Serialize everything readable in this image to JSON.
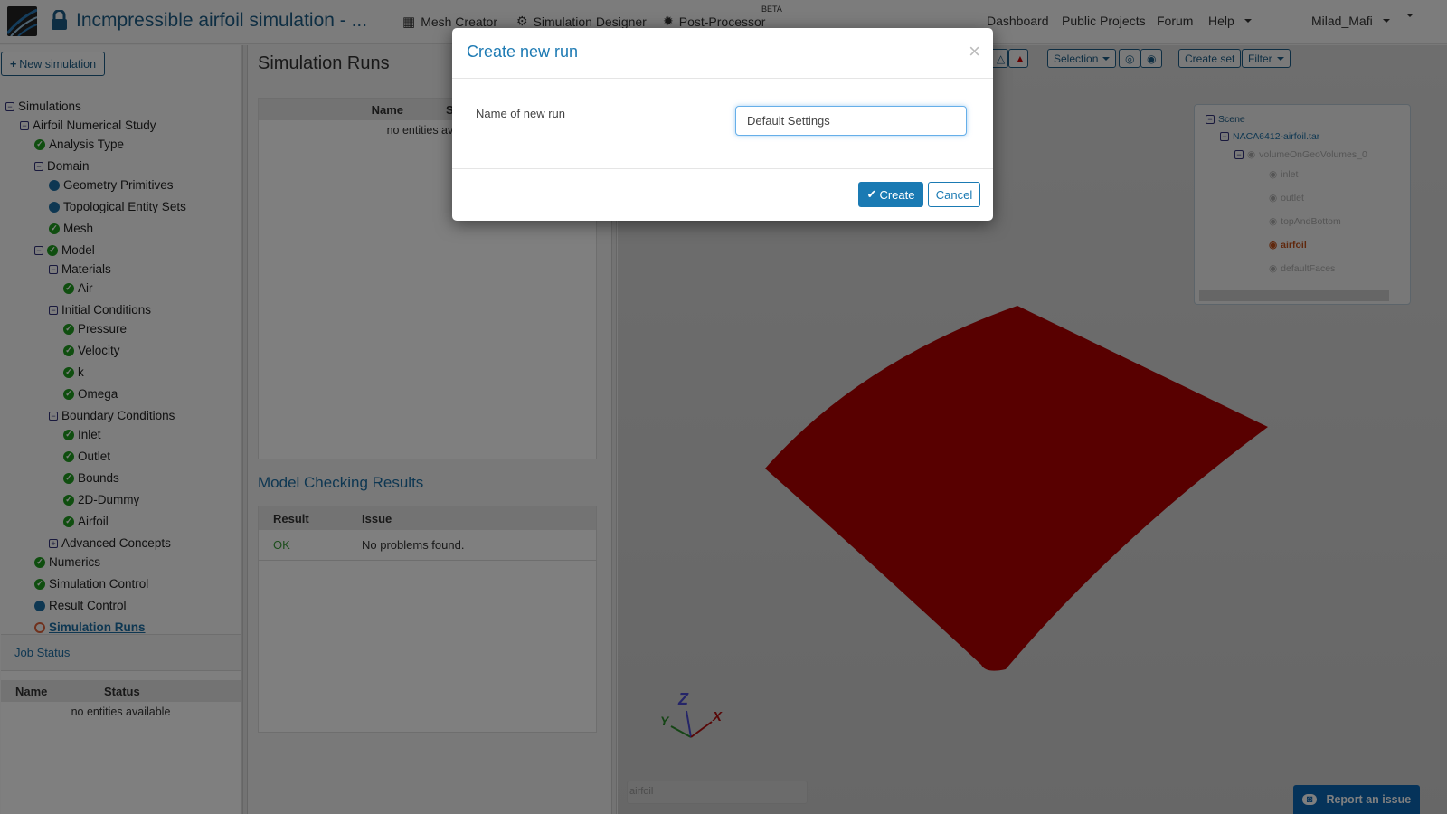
{
  "header": {
    "title": "Incmpressible airfoil simulation - ...",
    "nav": [
      "Mesh Creator",
      "Simulation Designer",
      "Post-Processor"
    ],
    "beta": "BETA",
    "right": [
      "Dashboard",
      "Public Projects",
      "Forum",
      "Help"
    ],
    "user": "Milad_Mafi"
  },
  "sidebar": {
    "new_simulation": "New simulation",
    "tree": [
      {
        "label": "Simulations",
        "level": 0,
        "icon": "minus"
      },
      {
        "label": "Airfoil Numerical Study",
        "level": 1,
        "icon": "minus"
      },
      {
        "label": "Analysis Type",
        "level": 2,
        "icon": "check"
      },
      {
        "label": "Domain",
        "level": 2,
        "icon": "minus"
      },
      {
        "label": "Geometry Primitives",
        "level": 3,
        "icon": "dot"
      },
      {
        "label": "Topological Entity Sets",
        "level": 3,
        "icon": "dot"
      },
      {
        "label": "Mesh",
        "level": 3,
        "icon": "check"
      },
      {
        "label": "Model",
        "level": 2,
        "icon": "minus-check"
      },
      {
        "label": "Materials",
        "level": 3,
        "icon": "minus"
      },
      {
        "label": "Air",
        "level": 4,
        "icon": "check"
      },
      {
        "label": "Initial Conditions",
        "level": 3,
        "icon": "minus"
      },
      {
        "label": "Pressure",
        "level": 4,
        "icon": "check"
      },
      {
        "label": "Velocity",
        "level": 4,
        "icon": "check"
      },
      {
        "label": "k",
        "level": 4,
        "icon": "check"
      },
      {
        "label": "Omega",
        "level": 4,
        "icon": "check"
      },
      {
        "label": "Boundary Conditions",
        "level": 3,
        "icon": "minus"
      },
      {
        "label": "Inlet",
        "level": 4,
        "icon": "check"
      },
      {
        "label": "Outlet",
        "level": 4,
        "icon": "check"
      },
      {
        "label": "Bounds",
        "level": 4,
        "icon": "check"
      },
      {
        "label": "2D-Dummy",
        "level": 4,
        "icon": "check"
      },
      {
        "label": "Airfoil",
        "level": 4,
        "icon": "check"
      },
      {
        "label": "Advanced Concepts",
        "level": 3,
        "icon": "plus"
      },
      {
        "label": "Numerics",
        "level": 2,
        "icon": "check"
      },
      {
        "label": "Simulation Control",
        "level": 2,
        "icon": "check"
      },
      {
        "label": "Result Control",
        "level": 2,
        "icon": "dot"
      },
      {
        "label": "Simulation Runs",
        "level": 2,
        "icon": "ring",
        "active": true
      }
    ],
    "job_status": {
      "title": "Job Status",
      "columns": [
        "Name",
        "Status"
      ],
      "empty": "no entities available"
    }
  },
  "middle": {
    "title": "Simulation Runs",
    "runs_columns": [
      "Name",
      "Status"
    ],
    "runs_empty": "no entities available",
    "checks_title": "Model Checking Results",
    "checks_columns": [
      "Result",
      "Issue"
    ],
    "checks_rows": [
      {
        "result": "OK",
        "issue": "No problems found."
      }
    ]
  },
  "viewport": {
    "toolbar": {
      "selection": "Selection",
      "create_set": "Create set",
      "filter": "Filter"
    },
    "scene": {
      "root": "Scene",
      "file": "NACA6412-airfoil.tar",
      "volume": "volumeOnGeoVolumes_0",
      "faces": [
        "inlet",
        "outlet",
        "topAndBottom",
        "airfoil",
        "defaultFaces"
      ],
      "selected": "airfoil"
    },
    "axes": {
      "x": "X",
      "y": "Y",
      "z": "Z"
    },
    "selection_box": "airfoil",
    "model_color": "#b00000"
  },
  "modal": {
    "title": "Create new run",
    "field_label": "Name of new run",
    "field_value": "Default Settings",
    "create": "Create",
    "cancel": "Cancel"
  },
  "report": "Report an issue"
}
